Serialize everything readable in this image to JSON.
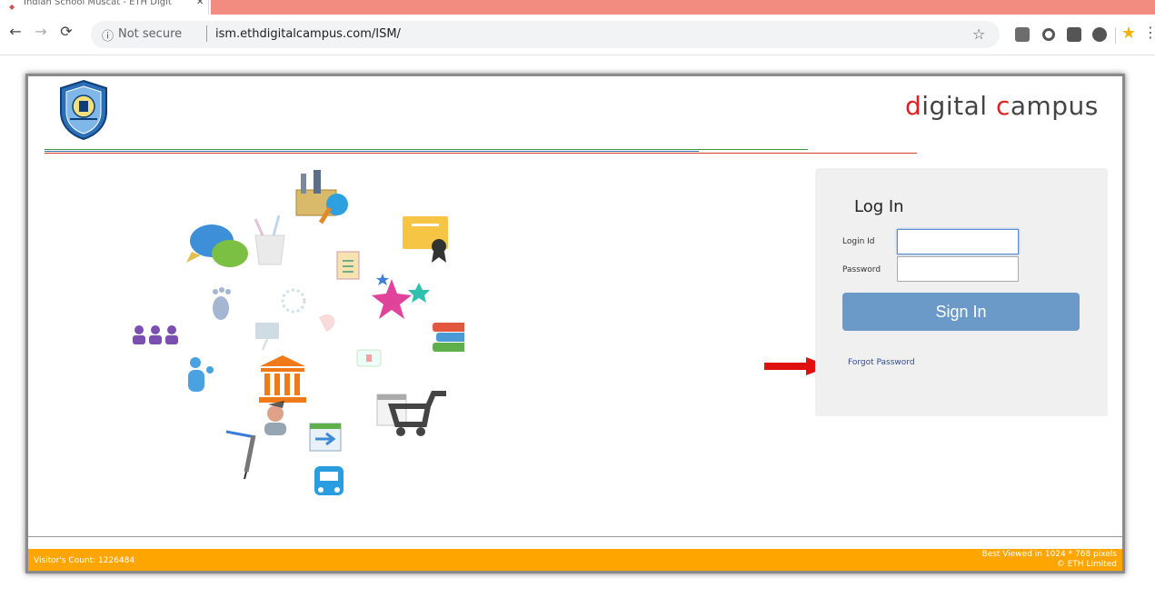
{
  "browser": {
    "tab_title": "Indian School Muscat - ETH Digit",
    "tab_close": "✕",
    "url_info": "Not secure",
    "url": "ism.ethdigitalcampus.com/ISM/"
  },
  "header": {
    "brand_d": "d",
    "brand_rest1": "igital ",
    "brand_c": "c",
    "brand_rest2": "ampus"
  },
  "login": {
    "title": "Log In",
    "login_id_label": "Login Id",
    "password_label": "Password",
    "sign_in": "Sign In",
    "forgot": "Forgot Password"
  },
  "footer": {
    "visitors": "Visitor's Count: 1226484",
    "best_viewed": "Best Viewed in 1024 * 768 pixels",
    "copyright": "© ETH Limited"
  },
  "colors": {
    "accent_red": "#e02020",
    "footer_orange": "#ffa500",
    "button_blue": "#6c9ac8"
  }
}
